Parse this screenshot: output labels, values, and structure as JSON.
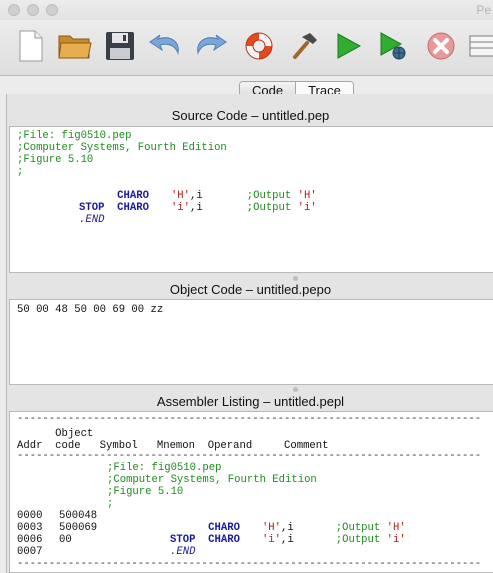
{
  "window": {
    "title": "Pe"
  },
  "toolbar": {
    "buttons": [
      {
        "name": "new-icon"
      },
      {
        "name": "open-folder-icon"
      },
      {
        "name": "save-icon"
      },
      {
        "name": "undo-icon"
      },
      {
        "name": "redo-icon"
      },
      {
        "name": "help-lifebuoy-icon"
      },
      {
        "name": "build-hammer-icon"
      },
      {
        "name": "run-icon"
      },
      {
        "name": "debug-run-icon"
      },
      {
        "name": "stop-icon"
      }
    ]
  },
  "tabs": {
    "code": "Code",
    "trace": "Trace",
    "active": "Code"
  },
  "source_pane": {
    "title": "Source Code – untitled.pep",
    "comments": [
      ";File: fig0510.pep",
      ";Computer Systems, Fourth Edition",
      ";Figure 5.10",
      ";"
    ],
    "instructions": [
      {
        "mnemonic": "CHARO",
        "operand_char": "'H'",
        "operand_mode": ",i",
        "comment_prefix": ";Output ",
        "comment_char": "'H'"
      },
      {
        "mnemonic": "CHARO",
        "operand_char": "'i'",
        "operand_mode": ",i",
        "comment_prefix": ";Output ",
        "comment_char": "'i'"
      },
      {
        "mnemonic": "STOP"
      },
      {
        "directive": ".END"
      }
    ]
  },
  "object_pane": {
    "title": "Object Code – untitled.pepo",
    "code": "50 00 48 50 00 69 00 zz"
  },
  "listing_pane": {
    "title": "Assembler Listing – untitled.pepl",
    "dash_line": "-------------------------------------------------------------------------",
    "header_row1": "      Object",
    "header_row2": "Addr  code   Symbol   Mnemon  Operand     Comment",
    "comments": [
      ";File: fig0510.pep",
      ";Computer Systems, Fourth Edition",
      ";Figure 5.10",
      ";"
    ],
    "rows": [
      {
        "addr": "0000",
        "code": "500048",
        "mnemonic": "CHARO",
        "operand_char": "'H'",
        "operand_mode": ",i",
        "comment_prefix": ";Output ",
        "comment_char": "'H'"
      },
      {
        "addr": "0003",
        "code": "500069",
        "mnemonic": "CHARO",
        "operand_char": "'i'",
        "operand_mode": ",i",
        "comment_prefix": ";Output ",
        "comment_char": "'i'"
      },
      {
        "addr": "0006",
        "code": "00",
        "mnemonic": "STOP"
      },
      {
        "addr": "0007",
        "directive": ".END"
      }
    ]
  }
}
